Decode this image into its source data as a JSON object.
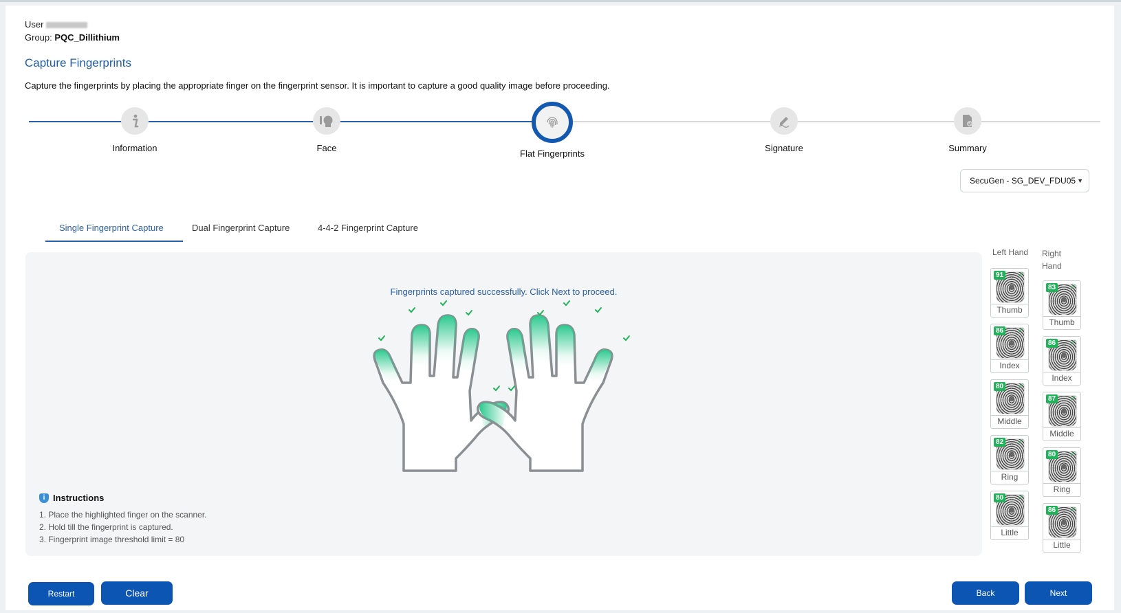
{
  "header": {
    "user_label": "User",
    "group_label": "Group:",
    "group_value": "PQC_Dillithium"
  },
  "page": {
    "title": "Capture Fingerprints",
    "description": "Capture the fingerprints by placing the appropriate finger on the fingerprint sensor. It is important to capture a good quality image before proceeding."
  },
  "stepper": {
    "steps": [
      {
        "label": "Information",
        "icon": "info-icon",
        "state": "done"
      },
      {
        "label": "Face",
        "icon": "face-icon",
        "state": "done"
      },
      {
        "label": "Flat Fingerprints",
        "icon": "fingerprint-icon",
        "state": "active"
      },
      {
        "label": "Signature",
        "icon": "signature-icon",
        "state": "todo"
      },
      {
        "label": "Summary",
        "icon": "summary-icon",
        "state": "todo"
      }
    ]
  },
  "device": {
    "selected": "SecuGen - SG_DEV_FDU05"
  },
  "tabs": [
    {
      "label": "Single Fingerprint Capture",
      "active": true
    },
    {
      "label": "Dual Fingerprint Capture",
      "active": false
    },
    {
      "label": "4-4-2 Fingerprint Capture",
      "active": false
    }
  ],
  "capture": {
    "status_message": "Fingerprints captured successfully. Click Next to proceed.",
    "instructions_title": "Instructions",
    "instructions": [
      "1. Place the highlighted finger on the scanner.",
      "2. Hold till the fingerprint is captured.",
      "3. Fingerprint image threshold limit = 80"
    ]
  },
  "left_hand": {
    "label": "Left Hand",
    "fingers": [
      {
        "name": "Thumb",
        "score": "91"
      },
      {
        "name": "Index",
        "score": "86"
      },
      {
        "name": "Middle",
        "score": "80"
      },
      {
        "name": "Ring",
        "score": "82"
      },
      {
        "name": "Little",
        "score": "80"
      }
    ]
  },
  "right_hand": {
    "label_line1": "Right",
    "label_line2": "Hand",
    "fingers": [
      {
        "name": "Thumb",
        "score": "83"
      },
      {
        "name": "Index",
        "score": "86"
      },
      {
        "name": "Middle",
        "score": "87"
      },
      {
        "name": "Ring",
        "score": "80"
      },
      {
        "name": "Little",
        "score": "86"
      }
    ]
  },
  "buttons": {
    "restart": "Restart",
    "clear": "Clear",
    "back": "Back",
    "next": "Next"
  },
  "colors": {
    "primary": "#0d55b3",
    "accent_blue": "#2a5fa8",
    "success_green": "#22b35a",
    "finger_highlight": "#2fc98f"
  }
}
